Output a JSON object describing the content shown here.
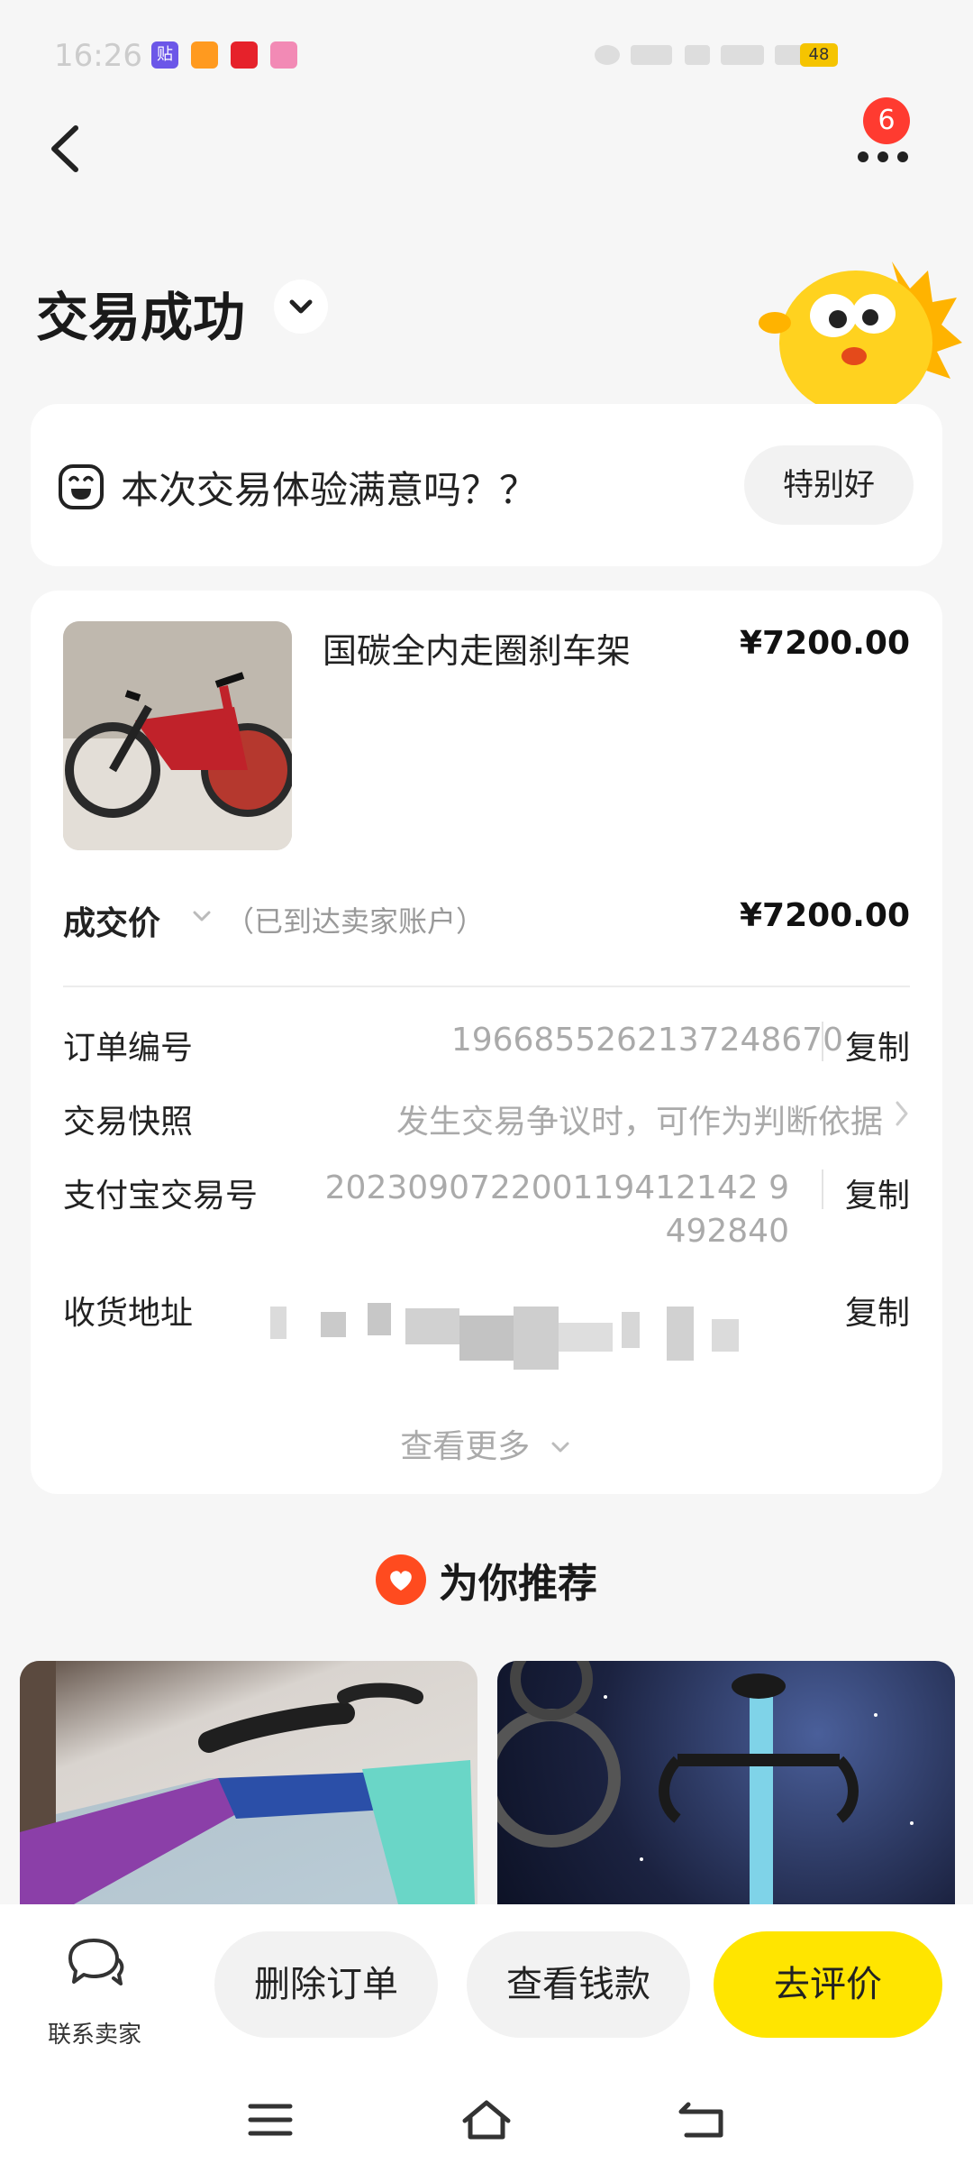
{
  "status_bar": {
    "time": "16:26",
    "battery": "48",
    "apps": [
      {
        "name": "tieba-app-icon",
        "glyph": "贴",
        "color": "#6c57e8"
      },
      {
        "name": "heart-app-icon",
        "glyph": "",
        "color": "#ff9a1f"
      },
      {
        "name": "red-app-icon",
        "glyph": "",
        "color": "#e6222b"
      },
      {
        "name": "cat-app-icon",
        "glyph": "",
        "color": "#f28ab5"
      }
    ]
  },
  "header": {
    "badge_count": "6",
    "title": "交易成功"
  },
  "survey": {
    "question": "本次交易体验满意吗？？",
    "answer": "特别好"
  },
  "product": {
    "title": "国碳全内走圈刹车架",
    "price": "¥7200.00"
  },
  "deal": {
    "label": "成交价",
    "note": "（已到达卖家账户）",
    "price": "¥7200.00"
  },
  "details": {
    "order_label": "订单编号",
    "order_value": "1966855262137248670",
    "snapshot_label": "交易快照",
    "snapshot_value": "发生交易争议时，可作为判断依据",
    "alipay_label": "支付宝交易号",
    "alipay_line1": "202309072200119412142 9",
    "alipay_line2": "492840",
    "address_label": "收货地址",
    "copy_label": "复制",
    "see_more": "查看更多"
  },
  "recommend": {
    "title": "为你推荐"
  },
  "actions": {
    "contact": "联系卖家",
    "delete": "删除订单",
    "view_payment": "查看钱款",
    "review": "去评价"
  },
  "colors": {
    "accent_yellow": "#ffe500",
    "badge_red": "#ff3b30",
    "recommend_red": "#ff4b1f"
  }
}
